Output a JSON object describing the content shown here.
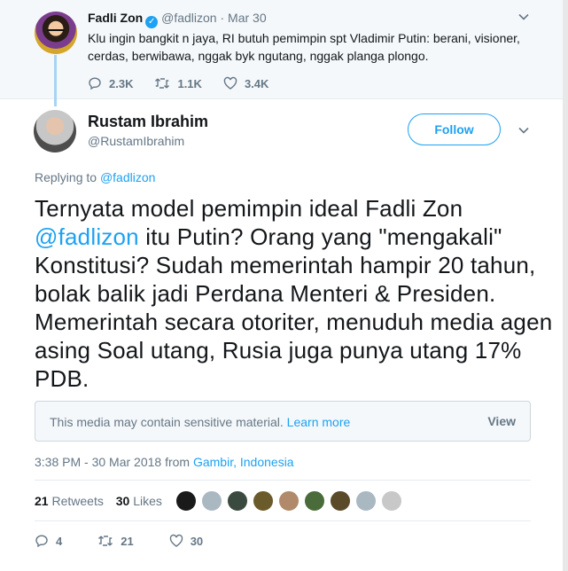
{
  "parent_tweet": {
    "name": "Fadli Zon",
    "handle": "@fadlizon",
    "dot": "·",
    "date": "Mar 30",
    "text": "Klu ingin bangkit n jaya, RI butuh pemimpin spt Vladimir Putin: berani, visioner, cerdas, berwibawa, nggak byk ngutang, nggak planga plongo.",
    "replies": "2.3K",
    "retweets": "1.1K",
    "likes": "3.4K"
  },
  "main_tweet": {
    "name": "Rustam Ibrahim",
    "handle": "@RustamIbrahim",
    "follow_label": "Follow",
    "replying_prefix": "Replying to",
    "replying_handle": "@fadlizon",
    "text_part1": "Ternyata model pemimpin ideal Fadli Zon ",
    "text_mention": "@fadlizon",
    "text_part2": " itu Putin?  Orang yang \"mengakali\" Konstitusi? Sudah memerintah hampir 20 tahun, bolak balik jadi Perdana Menteri & Presiden. Memerintah secara otoriter, menuduh media agen asing  Soal utang, Rusia juga punya utang 17% PDB.",
    "sensitive_text": "This media may contain sensitive material.",
    "learn_more": "Learn more",
    "view_label": "View",
    "timestamp": "3:38 PM - 30 Mar 2018 from",
    "location": "Gambir, Indonesia",
    "retweets_count": "21",
    "retweets_label": "Retweets",
    "likes_count": "30",
    "likes_label": "Likes",
    "reply_count": "4",
    "retweet_count_bottom": "21",
    "like_count_bottom": "30"
  },
  "colors": {
    "accent": "#1da1f2",
    "muted": "#657786",
    "text": "#14171a"
  }
}
